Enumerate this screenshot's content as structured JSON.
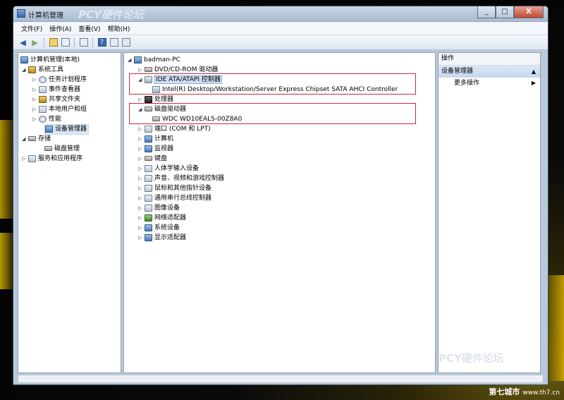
{
  "window": {
    "title": "计算机管理",
    "buttons": {
      "minimize": "_",
      "maximize": "□",
      "close": "X"
    }
  },
  "menubar": [
    "文件(F)",
    "操作(A)",
    "查看(V)",
    "帮助(H)"
  ],
  "toolbar": {
    "icons": [
      "back-arrow-icon",
      "forward-arrow-icon",
      "up-folder-icon",
      "show-tree-icon",
      "export-list-icon",
      "help-icon",
      "properties-icon",
      "scan-icon"
    ],
    "help_label": "?"
  },
  "tree": {
    "root": "计算机管理(本地)",
    "system_tools": "系统工具",
    "items": [
      "任务计划程序",
      "事件查看器",
      "共享文件夹",
      "本地用户和组",
      "性能",
      "设备管理器"
    ],
    "storage": "存储",
    "storage_items": [
      "磁盘管理"
    ],
    "services": "服务和应用程序"
  },
  "devices": {
    "root": "badman-PC",
    "categories": [
      {
        "label": "DVD/CD-ROM 驱动器",
        "expanded": false
      },
      {
        "label": "IDE ATA/ATAPI 控制器",
        "expanded": true,
        "children": [
          "Intel(R) Desktop/Workstation/Server Express Chipset SATA AHCI Controller"
        ]
      },
      {
        "label": "处理器",
        "expanded": false
      },
      {
        "label": "磁盘驱动器",
        "expanded": true,
        "children": [
          "WDC WD10EALS-00Z8A0"
        ]
      },
      {
        "label": "端口 (COM 和 LPT)",
        "expanded": false
      },
      {
        "label": "计算机",
        "expanded": false
      },
      {
        "label": "监视器",
        "expanded": false
      },
      {
        "label": "键盘",
        "expanded": false
      },
      {
        "label": "人体学输入设备",
        "expanded": false
      },
      {
        "label": "声音、视频和游戏控制器",
        "expanded": false
      },
      {
        "label": "鼠标和其他指针设备",
        "expanded": false
      },
      {
        "label": "通用串行总线控制器",
        "expanded": false
      },
      {
        "label": "图像设备",
        "expanded": false
      },
      {
        "label": "网络适配器",
        "expanded": false
      },
      {
        "label": "系统设备",
        "expanded": false
      },
      {
        "label": "显示适配器",
        "expanded": false
      }
    ]
  },
  "actions": {
    "header": "操作",
    "section": "设备管理器",
    "more": "更多操作"
  },
  "watermarks": {
    "top": "PCY硬件论坛",
    "bottom": "PCY硬件论坛",
    "site": "第七城市",
    "url": "www.th7.cn"
  },
  "colors": {
    "annotation_box": "#c0303a",
    "selection": "#cfe0f5"
  }
}
